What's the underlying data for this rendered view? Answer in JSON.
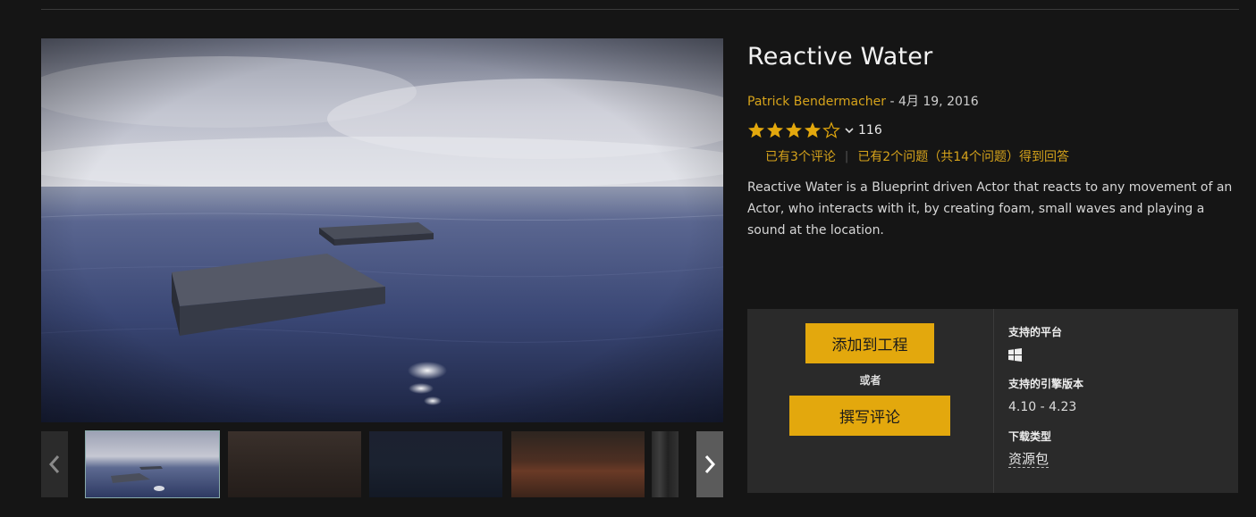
{
  "product": {
    "title": "Reactive Water",
    "author": "Patrick Bendermacher",
    "separator": " - ",
    "date": "4月 19, 2016",
    "rating": {
      "stars_filled": 4,
      "stars_total": 5,
      "count": "116"
    },
    "reviews_link": "已有3个评论",
    "link_separator": "|",
    "questions_link": "已有2个问题（共14个问题）得到回答",
    "description": "Reactive Water is a Blueprint driven Actor that reacts to any movement of an Actor, who interacts with it, by creating foam, small waves and playing a sound at the location."
  },
  "actions": {
    "add_to_project": "添加到工程",
    "or": "或者",
    "write_review": "撰写评论"
  },
  "specs": {
    "platforms_label": "支持的平台",
    "platform_icon": "windows-icon",
    "engine_label": "支持的引擎版本",
    "engine_versions": "4.10 - 4.23",
    "download_type_label": "下载类型",
    "download_type": "资源包"
  },
  "gallery": {
    "prev_icon": "chevron-left-icon",
    "next_icon": "chevron-right-icon",
    "thumbnails": 5
  },
  "colors": {
    "accent": "#e3a80d",
    "link": "#d6a31b",
    "background": "#151515",
    "panel": "#2a2a2a"
  }
}
